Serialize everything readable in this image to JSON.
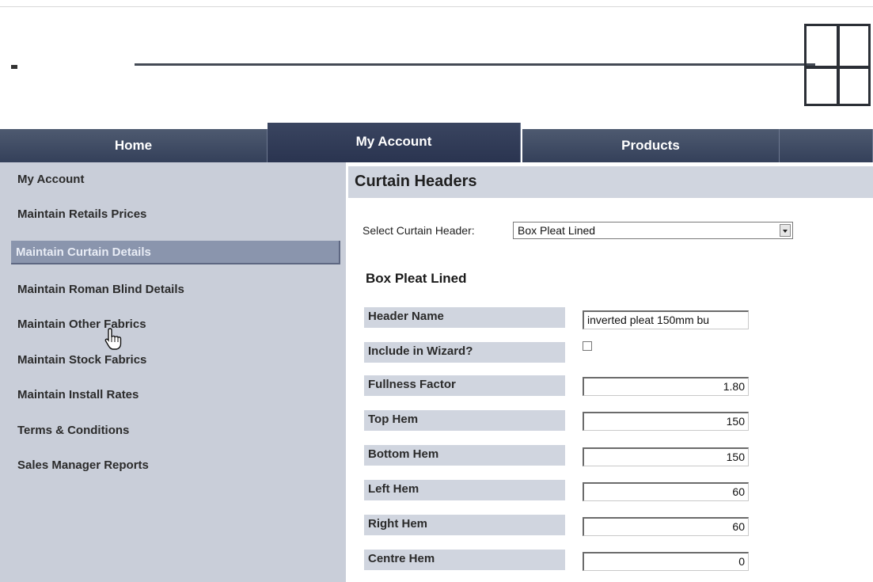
{
  "nav": {
    "tabs": [
      {
        "label": "Home"
      },
      {
        "label": "My Account"
      },
      {
        "label": "Products"
      },
      {
        "label": ""
      }
    ]
  },
  "sidebar": {
    "items": [
      {
        "label": "My Account"
      },
      {
        "label": "Maintain Retails Prices"
      },
      {
        "label": "Maintain Curtain Details"
      },
      {
        "label": "Maintain Roman Blind Details"
      },
      {
        "label": "Maintain Other Fabrics"
      },
      {
        "label": "Maintain Stock Fabrics"
      },
      {
        "label": "Maintain Install Rates"
      },
      {
        "label": "Terms & Conditions"
      },
      {
        "label": "Sales Manager Reports"
      }
    ]
  },
  "main": {
    "title": "Curtain Headers",
    "select_label": "Select Curtain Header:",
    "select_value": "Box Pleat Lined",
    "section_heading": "Box Pleat Lined",
    "fields": [
      {
        "label": "Header Name",
        "value": "inverted pleat 150mm bu"
      },
      {
        "label": "Include in Wizard?",
        "value": ""
      },
      {
        "label": "Fullness Factor",
        "value": "1.80"
      },
      {
        "label": "Top Hem",
        "value": "150"
      },
      {
        "label": "Bottom Hem",
        "value": "150"
      },
      {
        "label": "Left Hem",
        "value": "60"
      },
      {
        "label": "Right Hem",
        "value": "60"
      },
      {
        "label": "Centre Hem",
        "value": "0"
      }
    ]
  },
  "colors": {
    "nav": "#3a4560",
    "sidebar": "#c9ced9",
    "sidebar_active": "#8a95ad",
    "label_bg": "#d0d5df"
  }
}
